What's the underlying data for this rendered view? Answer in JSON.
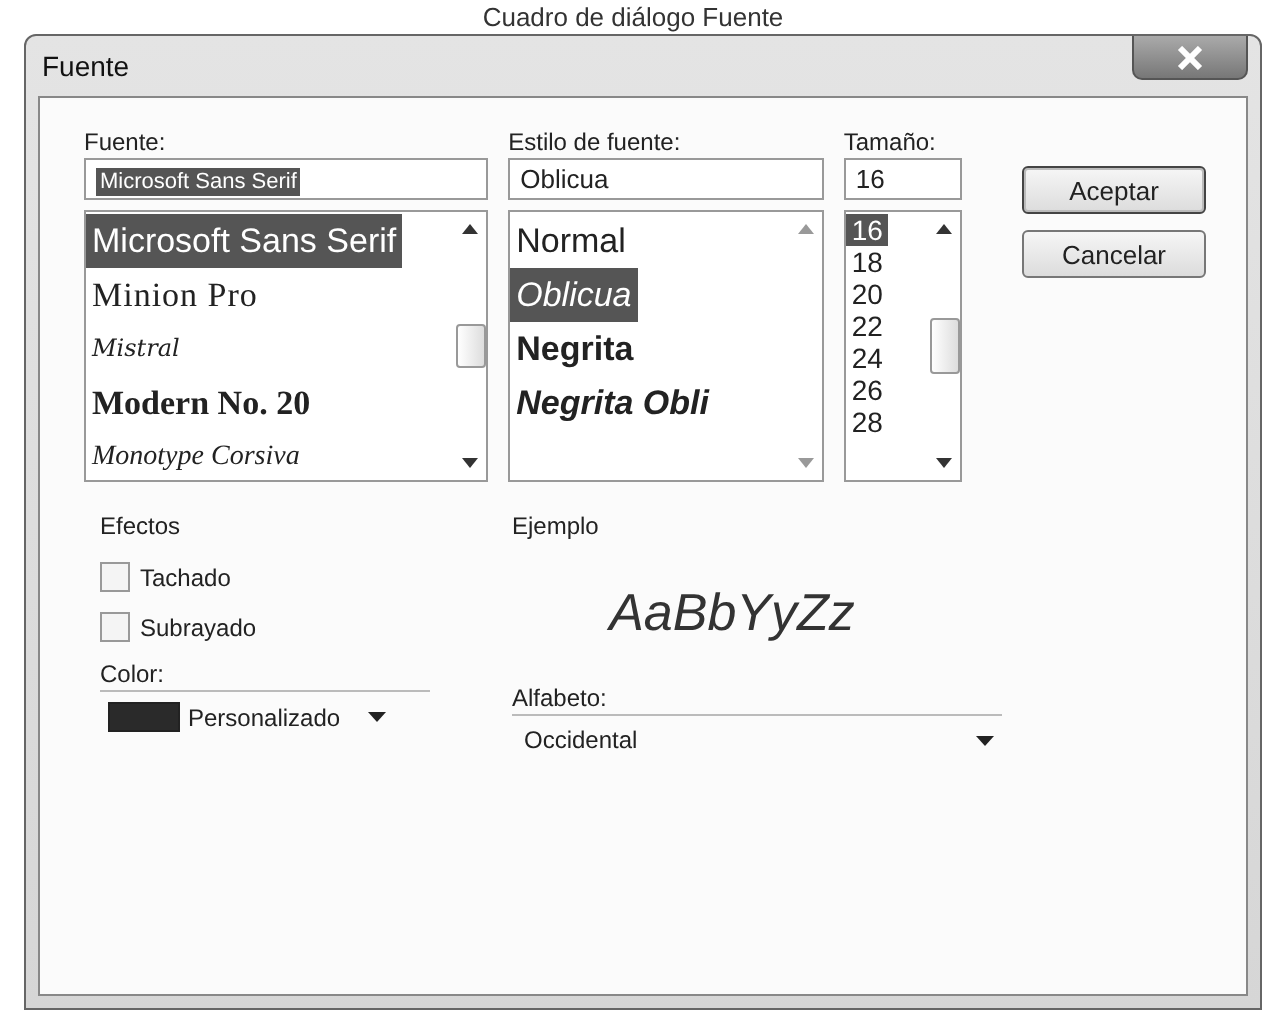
{
  "caption": "Cuadro de diálogo Fuente",
  "window": {
    "title": "Fuente"
  },
  "font": {
    "label": "Fuente:",
    "value": "Microsoft Sans Serif",
    "items": [
      {
        "label": "Microsoft Sans Serif",
        "kind": "sans",
        "selected": true
      },
      {
        "label": "Minion Pro",
        "kind": "serif",
        "selected": false
      },
      {
        "label": "Mistral",
        "kind": "script",
        "selected": false
      },
      {
        "label": "Modern No. 20",
        "kind": "modern",
        "selected": false
      },
      {
        "label": "Monotype Corsiva",
        "kind": "corsiva",
        "selected": false
      }
    ]
  },
  "style": {
    "label": "Estilo de fuente:",
    "value": "Oblicua",
    "items": [
      {
        "label": "Normal",
        "kind": "normal",
        "selected": false
      },
      {
        "label": "Oblicua",
        "kind": "italic",
        "selected": true
      },
      {
        "label": "Negrita",
        "kind": "bold",
        "selected": false
      },
      {
        "label": "Negrita Obli",
        "kind": "bolditalic",
        "selected": false
      }
    ]
  },
  "size": {
    "label": "Tamaño:",
    "value": "16",
    "items": [
      {
        "label": "16",
        "selected": true
      },
      {
        "label": "18",
        "selected": false
      },
      {
        "label": "20",
        "selected": false
      },
      {
        "label": "22",
        "selected": false
      },
      {
        "label": "24",
        "selected": false
      },
      {
        "label": "26",
        "selected": false
      },
      {
        "label": "28",
        "selected": false
      }
    ]
  },
  "buttons": [
    "Aceptar",
    "Cancelar"
  ],
  "effects": {
    "label": "Efectos",
    "items": [
      {
        "label": "Tachado",
        "checked": false
      },
      {
        "label": "Subrayado",
        "checked": false
      }
    ]
  },
  "color": {
    "label": "Color:",
    "value": "Personalizado"
  },
  "sample": {
    "label": "Ejemplo",
    "text": "AaBbYyZz"
  },
  "script": {
    "label": "Alfabeto:",
    "value": "Occidental"
  }
}
